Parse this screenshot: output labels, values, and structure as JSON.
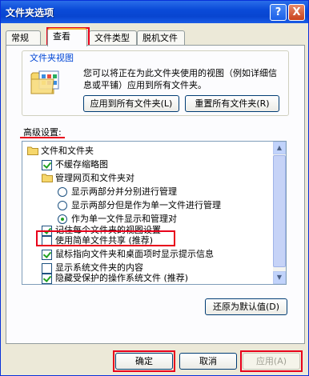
{
  "window": {
    "title": "文件夹选项",
    "help_button": "?",
    "close_button": "X"
  },
  "tabs": [
    {
      "label": "常规",
      "active": false
    },
    {
      "label": "查看",
      "active": true
    },
    {
      "label": "文件类型",
      "active": false
    },
    {
      "label": "脱机文件",
      "active": false
    }
  ],
  "folder_views": {
    "title": "文件夹视图",
    "description": "您可以将正在为此文件夹使用的视图（例如详细信息或平铺）应用到所有文件夹。",
    "apply_all_button": "应用到所有文件夹(L)",
    "reset_all_button": "重置所有文件夹(R)"
  },
  "advanced": {
    "label": "高级设置:",
    "items": [
      {
        "type": "folder",
        "label": "文件和文件夹"
      },
      {
        "type": "checkbox",
        "label": "不缓存缩略图",
        "checked": true
      },
      {
        "type": "folder",
        "label": "管理网页和文件夹对"
      },
      {
        "type": "radio",
        "label": "显示两部分并分别进行管理",
        "selected": false
      },
      {
        "type": "radio",
        "label": "显示两部分但是作为单一文件进行管理",
        "selected": false
      },
      {
        "type": "radio",
        "label": "作为单一文件显示和管理对",
        "selected": true
      },
      {
        "type": "checkbox",
        "label": "记住每个文件夹的视图设置",
        "checked": true
      },
      {
        "type": "checkbox",
        "label": "使用简单文件共享 (推荐)",
        "checked": false
      },
      {
        "type": "checkbox",
        "label": "鼠标指向文件夹和桌面项时显示提示信息",
        "checked": true
      },
      {
        "type": "checkbox",
        "label": "显示系统文件夹的内容",
        "checked": false
      },
      {
        "type": "checkbox",
        "label": "隐藏受保护的操作系统文件 (推荐)",
        "checked": true
      }
    ]
  },
  "restore_defaults_button": "还原为默认值(D)",
  "footer": {
    "ok_button": "确定",
    "cancel_button": "取消",
    "apply_button": "应用(A)"
  },
  "colors": {
    "title_bar": "#0a4bd8",
    "highlight": "#e8001b",
    "group_title": "#0046d5",
    "dialog_face": "#ece9d8"
  }
}
